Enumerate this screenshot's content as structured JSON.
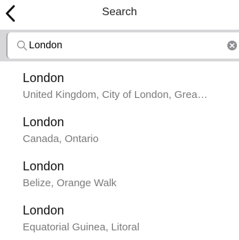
{
  "nav": {
    "back_icon": "chevron-left-icon",
    "title": "Search"
  },
  "search": {
    "value": "London",
    "icon": "search-icon",
    "clear_icon": "clear-circle-icon"
  },
  "results": [
    {
      "title": "London",
      "subtitle": "United Kingdom, City of London, Grea…"
    },
    {
      "title": "London",
      "subtitle": "Canada, Ontario"
    },
    {
      "title": "London",
      "subtitle": "Belize, Orange Walk"
    },
    {
      "title": "London",
      "subtitle": "Equatorial Guinea, Litoral"
    }
  ],
  "colors": {
    "search_bar_background": "#d7d7d9",
    "subtitle_text": "#7a7a7a",
    "title_text": "#111111"
  }
}
